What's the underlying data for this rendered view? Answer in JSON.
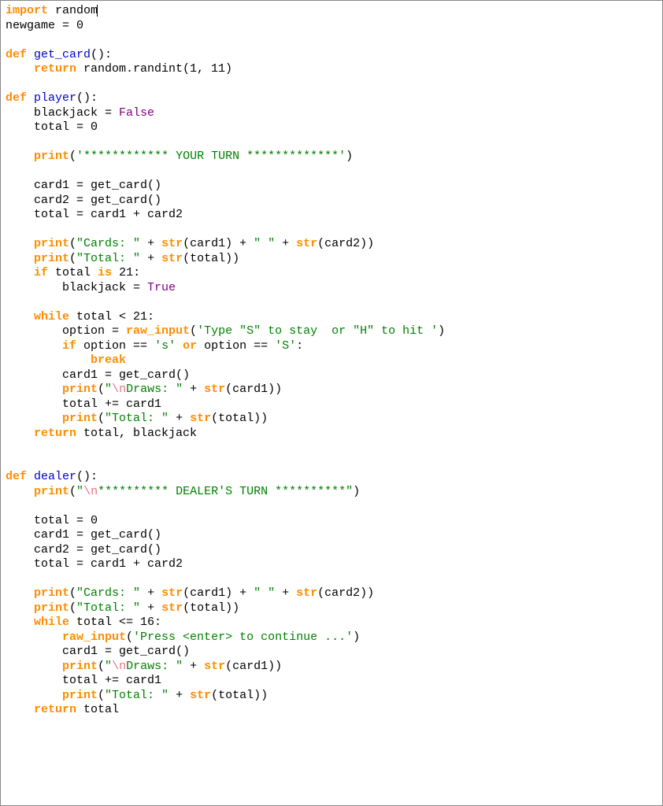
{
  "code": {
    "lines": [
      {
        "tokens": [
          {
            "t": "import ",
            "c": "kw"
          },
          {
            "t": "random",
            "c": ""
          },
          {
            "t": "",
            "c": "caret"
          }
        ]
      },
      {
        "tokens": [
          {
            "t": "newgame = 0",
            "c": ""
          }
        ]
      },
      {
        "tokens": [
          {
            "t": "",
            "c": ""
          }
        ]
      },
      {
        "tokens": [
          {
            "t": "def ",
            "c": "kw"
          },
          {
            "t": "get_card",
            "c": "fn"
          },
          {
            "t": "():",
            "c": ""
          }
        ]
      },
      {
        "tokens": [
          {
            "t": "    ",
            "c": ""
          },
          {
            "t": "return ",
            "c": "kw"
          },
          {
            "t": "random.randint(1, 11)",
            "c": ""
          }
        ]
      },
      {
        "tokens": [
          {
            "t": "",
            "c": ""
          }
        ]
      },
      {
        "tokens": [
          {
            "t": "def ",
            "c": "kw"
          },
          {
            "t": "player",
            "c": "fn"
          },
          {
            "t": "():",
            "c": ""
          }
        ]
      },
      {
        "tokens": [
          {
            "t": "    blackjack = ",
            "c": ""
          },
          {
            "t": "False",
            "c": "bool"
          }
        ]
      },
      {
        "tokens": [
          {
            "t": "    total = 0",
            "c": ""
          }
        ]
      },
      {
        "tokens": [
          {
            "t": "",
            "c": ""
          }
        ]
      },
      {
        "tokens": [
          {
            "t": "    ",
            "c": ""
          },
          {
            "t": "print",
            "c": "kw"
          },
          {
            "t": "(",
            "c": ""
          },
          {
            "t": "'************ YOUR TURN *************'",
            "c": "str"
          },
          {
            "t": ")",
            "c": ""
          }
        ]
      },
      {
        "tokens": [
          {
            "t": "",
            "c": ""
          }
        ]
      },
      {
        "tokens": [
          {
            "t": "    card1 = get_card()",
            "c": ""
          }
        ]
      },
      {
        "tokens": [
          {
            "t": "    card2 = get_card()",
            "c": ""
          }
        ]
      },
      {
        "tokens": [
          {
            "t": "    total = card1 + card2",
            "c": ""
          }
        ]
      },
      {
        "tokens": [
          {
            "t": "",
            "c": ""
          }
        ]
      },
      {
        "tokens": [
          {
            "t": "    ",
            "c": ""
          },
          {
            "t": "print",
            "c": "kw"
          },
          {
            "t": "(",
            "c": ""
          },
          {
            "t": "\"Cards: \"",
            "c": "str"
          },
          {
            "t": " + ",
            "c": ""
          },
          {
            "t": "str",
            "c": "kw"
          },
          {
            "t": "(card1) + ",
            "c": ""
          },
          {
            "t": "\" \"",
            "c": "str"
          },
          {
            "t": " + ",
            "c": ""
          },
          {
            "t": "str",
            "c": "kw"
          },
          {
            "t": "(card2))",
            "c": ""
          }
        ]
      },
      {
        "tokens": [
          {
            "t": "    ",
            "c": ""
          },
          {
            "t": "print",
            "c": "kw"
          },
          {
            "t": "(",
            "c": ""
          },
          {
            "t": "\"Total: \"",
            "c": "str"
          },
          {
            "t": " + ",
            "c": ""
          },
          {
            "t": "str",
            "c": "kw"
          },
          {
            "t": "(total))",
            "c": ""
          }
        ]
      },
      {
        "tokens": [
          {
            "t": "    ",
            "c": ""
          },
          {
            "t": "if",
            "c": "kw"
          },
          {
            "t": " total ",
            "c": ""
          },
          {
            "t": "is",
            "c": "kw"
          },
          {
            "t": " 21:",
            "c": ""
          }
        ]
      },
      {
        "tokens": [
          {
            "t": "        blackjack = ",
            "c": ""
          },
          {
            "t": "True",
            "c": "bool"
          }
        ]
      },
      {
        "tokens": [
          {
            "t": "",
            "c": ""
          }
        ]
      },
      {
        "tokens": [
          {
            "t": "    ",
            "c": ""
          },
          {
            "t": "while",
            "c": "kw"
          },
          {
            "t": " total < 21:",
            "c": ""
          }
        ]
      },
      {
        "tokens": [
          {
            "t": "        option = ",
            "c": ""
          },
          {
            "t": "raw_input",
            "c": "kw"
          },
          {
            "t": "(",
            "c": ""
          },
          {
            "t": "'Type \"S\" to stay  or \"H\" to hit '",
            "c": "str"
          },
          {
            "t": ")",
            "c": ""
          }
        ]
      },
      {
        "tokens": [
          {
            "t": "        ",
            "c": ""
          },
          {
            "t": "if",
            "c": "kw"
          },
          {
            "t": " option == ",
            "c": ""
          },
          {
            "t": "'s'",
            "c": "str"
          },
          {
            "t": " ",
            "c": ""
          },
          {
            "t": "or",
            "c": "kw"
          },
          {
            "t": " option == ",
            "c": ""
          },
          {
            "t": "'S'",
            "c": "str"
          },
          {
            "t": ":",
            "c": ""
          }
        ]
      },
      {
        "tokens": [
          {
            "t": "            ",
            "c": ""
          },
          {
            "t": "break",
            "c": "kw"
          }
        ]
      },
      {
        "tokens": [
          {
            "t": "        card1 = get_card()",
            "c": ""
          }
        ]
      },
      {
        "tokens": [
          {
            "t": "        ",
            "c": ""
          },
          {
            "t": "print",
            "c": "kw"
          },
          {
            "t": "(",
            "c": ""
          },
          {
            "t": "\"",
            "c": "str"
          },
          {
            "t": "\\n",
            "c": "esc"
          },
          {
            "t": "Draws: \"",
            "c": "str"
          },
          {
            "t": " + ",
            "c": ""
          },
          {
            "t": "str",
            "c": "kw"
          },
          {
            "t": "(card1))",
            "c": ""
          }
        ]
      },
      {
        "tokens": [
          {
            "t": "        total += card1",
            "c": ""
          }
        ]
      },
      {
        "tokens": [
          {
            "t": "        ",
            "c": ""
          },
          {
            "t": "print",
            "c": "kw"
          },
          {
            "t": "(",
            "c": ""
          },
          {
            "t": "\"Total: \"",
            "c": "str"
          },
          {
            "t": " + ",
            "c": ""
          },
          {
            "t": "str",
            "c": "kw"
          },
          {
            "t": "(total))",
            "c": ""
          }
        ]
      },
      {
        "tokens": [
          {
            "t": "    ",
            "c": ""
          },
          {
            "t": "return ",
            "c": "kw"
          },
          {
            "t": "total, blackjack",
            "c": ""
          }
        ]
      },
      {
        "tokens": [
          {
            "t": "",
            "c": ""
          }
        ]
      },
      {
        "tokens": [
          {
            "t": "",
            "c": ""
          }
        ]
      },
      {
        "tokens": [
          {
            "t": "def ",
            "c": "kw"
          },
          {
            "t": "dealer",
            "c": "fn"
          },
          {
            "t": "():",
            "c": ""
          }
        ]
      },
      {
        "tokens": [
          {
            "t": "    ",
            "c": ""
          },
          {
            "t": "print",
            "c": "kw"
          },
          {
            "t": "(",
            "c": ""
          },
          {
            "t": "\"",
            "c": "str"
          },
          {
            "t": "\\n",
            "c": "esc"
          },
          {
            "t": "********** DEALER'S TURN **********\"",
            "c": "str"
          },
          {
            "t": ")",
            "c": ""
          }
        ]
      },
      {
        "tokens": [
          {
            "t": "",
            "c": ""
          }
        ]
      },
      {
        "tokens": [
          {
            "t": "    total = 0",
            "c": ""
          }
        ]
      },
      {
        "tokens": [
          {
            "t": "    card1 = get_card()",
            "c": ""
          }
        ]
      },
      {
        "tokens": [
          {
            "t": "    card2 = get_card()",
            "c": ""
          }
        ]
      },
      {
        "tokens": [
          {
            "t": "    total = card1 + card2",
            "c": ""
          }
        ]
      },
      {
        "tokens": [
          {
            "t": "",
            "c": ""
          }
        ]
      },
      {
        "tokens": [
          {
            "t": "    ",
            "c": ""
          },
          {
            "t": "print",
            "c": "kw"
          },
          {
            "t": "(",
            "c": ""
          },
          {
            "t": "\"Cards: \"",
            "c": "str"
          },
          {
            "t": " + ",
            "c": ""
          },
          {
            "t": "str",
            "c": "kw"
          },
          {
            "t": "(card1) + ",
            "c": ""
          },
          {
            "t": "\" \"",
            "c": "str"
          },
          {
            "t": " + ",
            "c": ""
          },
          {
            "t": "str",
            "c": "kw"
          },
          {
            "t": "(card2))",
            "c": ""
          }
        ]
      },
      {
        "tokens": [
          {
            "t": "    ",
            "c": ""
          },
          {
            "t": "print",
            "c": "kw"
          },
          {
            "t": "(",
            "c": ""
          },
          {
            "t": "\"Total: \"",
            "c": "str"
          },
          {
            "t": " + ",
            "c": ""
          },
          {
            "t": "str",
            "c": "kw"
          },
          {
            "t": "(total))",
            "c": ""
          }
        ]
      },
      {
        "tokens": [
          {
            "t": "    ",
            "c": ""
          },
          {
            "t": "while",
            "c": "kw"
          },
          {
            "t": " total <= 16:",
            "c": ""
          }
        ]
      },
      {
        "tokens": [
          {
            "t": "        ",
            "c": ""
          },
          {
            "t": "raw_input",
            "c": "kw"
          },
          {
            "t": "(",
            "c": ""
          },
          {
            "t": "'Press <enter> to continue ...'",
            "c": "str"
          },
          {
            "t": ")",
            "c": ""
          }
        ]
      },
      {
        "tokens": [
          {
            "t": "        card1 = get_card()",
            "c": ""
          }
        ]
      },
      {
        "tokens": [
          {
            "t": "        ",
            "c": ""
          },
          {
            "t": "print",
            "c": "kw"
          },
          {
            "t": "(",
            "c": ""
          },
          {
            "t": "\"",
            "c": "str"
          },
          {
            "t": "\\n",
            "c": "esc"
          },
          {
            "t": "Draws: \"",
            "c": "str"
          },
          {
            "t": " + ",
            "c": ""
          },
          {
            "t": "str",
            "c": "kw"
          },
          {
            "t": "(card1))",
            "c": ""
          }
        ]
      },
      {
        "tokens": [
          {
            "t": "        total += card1",
            "c": ""
          }
        ]
      },
      {
        "tokens": [
          {
            "t": "        ",
            "c": ""
          },
          {
            "t": "print",
            "c": "kw"
          },
          {
            "t": "(",
            "c": ""
          },
          {
            "t": "\"Total: \"",
            "c": "str"
          },
          {
            "t": " + ",
            "c": ""
          },
          {
            "t": "str",
            "c": "kw"
          },
          {
            "t": "(total))",
            "c": ""
          }
        ]
      },
      {
        "tokens": [
          {
            "t": "    ",
            "c": ""
          },
          {
            "t": "return ",
            "c": "kw"
          },
          {
            "t": "total",
            "c": ""
          }
        ]
      }
    ]
  }
}
